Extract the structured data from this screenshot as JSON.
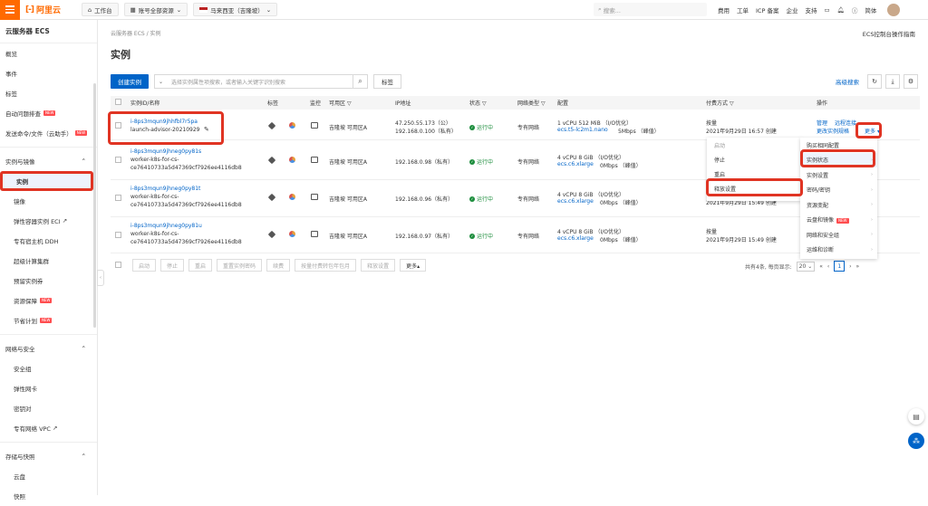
{
  "topbar": {
    "logo": "阿里云",
    "workbench": "工作台",
    "resources": "账号全部资源",
    "region": "马来西亚（吉隆坡）",
    "search_placeholder": "搜索...",
    "links": [
      "费用",
      "工单",
      "ICP 备案",
      "企业",
      "支持"
    ],
    "lang": "简体"
  },
  "sidebar": {
    "title": "云服务器 ECS",
    "items": [
      "概览",
      "事件",
      "标签",
      "自动问题排查",
      "发送命令/文件（云助手）"
    ],
    "group1": "实例与镜像",
    "group1_items": [
      "实例",
      "镜像",
      "弹性容器实例 ECI",
      "专有宿主机 DDH",
      "超级计算集群",
      "预留实例券",
      "资源保障",
      "节省计划"
    ],
    "group2": "网络与安全",
    "group2_items": [
      "安全组",
      "弹性网卡",
      "密钥对",
      "专有网络 VPC"
    ],
    "group3": "存储与快照",
    "group3_items": [
      "云盘",
      "快照"
    ],
    "new_badge": "NEW"
  },
  "main": {
    "breadcrumb": "云服务器 ECS / 实例",
    "guide": "ECS控制台操作指南",
    "title": "实例",
    "create_btn": "创建实例",
    "filter_placeholder": "选择实例属性项搜索，或者输入关键字识别搜索",
    "tag_btn": "标签",
    "advanced": "高级搜索",
    "headers": [
      "实例ID/名称",
      "标签",
      "监控",
      "可用区",
      "IP地址",
      "状态",
      "网络类型",
      "配置",
      "付费方式",
      "操作"
    ],
    "rows": [
      {
        "id": "i-8ps3mqun9jhhfbl7r5pa",
        "name": "launch-advisor-20210929",
        "name2": "",
        "zone": "吉隆坡 可用区A",
        "ip1": "47.250.55.173（公）",
        "ip2": "192.168.0.100（私有）",
        "status": "运行中",
        "net": "专有网络",
        "cfg": "1 vCPU 512 MiB （I/O优化）",
        "spec": "ecs.t5-lc2m1.nano",
        "bw": "5Mbps （峰值）",
        "pay": "按量",
        "date": "2021年9月29日 16:57 创建",
        "ops": [
          "管理",
          "远程连接",
          "更改实例规格",
          "更多"
        ]
      },
      {
        "id": "i-8ps3mqun9jhneg0py81s",
        "name": "worker-k8s-for-cs-",
        "name2": "ce76410733a5d47369cf7926ee4116db8",
        "zone": "吉隆坡 可用区A",
        "ip1": "192.168.0.98（私有）",
        "ip2": "",
        "status": "运行中",
        "net": "专有网络",
        "cfg": "4 vCPU 8 GiB （I/O优化）",
        "spec": "ecs.c6.xlarge",
        "bw": "0Mbps （峰值）",
        "pay": "",
        "date": "",
        "ops": []
      },
      {
        "id": "i-8ps3mqun9jhneg0py81t",
        "name": "worker-k8s-for-cs-",
        "name2": "ce76410733a5d47369cf7926ee4116db8",
        "zone": "吉隆坡 可用区A",
        "ip1": "192.168.0.96（私有）",
        "ip2": "",
        "status": "运行中",
        "net": "专有网络",
        "cfg": "4 vCPU 8 GiB （I/O优化）",
        "spec": "ecs.c6.xlarge",
        "bw": "0Mbps （峰值）",
        "pay": "",
        "date": "2021年9月29日 15:49 创建",
        "ops": []
      },
      {
        "id": "i-8ps3mqun9jhneg0py81u",
        "name": "worker-k8s-for-cs-",
        "name2": "ce76410733a5d47369cf7926ee4116db8",
        "zone": "吉隆坡 可用区A",
        "ip1": "192.168.0.97（私有）",
        "ip2": "",
        "status": "运行中",
        "net": "专有网络",
        "cfg": "4 vCPU 8 GiB （I/O优化）",
        "spec": "ecs.c6.xlarge",
        "bw": "0Mbps （峰值）",
        "pay": "按量",
        "date": "2021年9月29日 15:49 创建",
        "ops": []
      }
    ],
    "bulk": [
      "启动",
      "停止",
      "重启",
      "重置实例密码",
      "续费",
      "按量付费转包年包月",
      "释放设置",
      "更多▴"
    ],
    "pager": {
      "total": "共有4条, 每页显示:",
      "size": "20",
      "page": "1"
    }
  },
  "menu1": [
    "启动",
    "停止",
    "重启",
    "释放设置"
  ],
  "menu2": [
    "购买相同配置",
    "实例状态",
    "实例设置",
    "密码/密钥",
    "资源变配",
    "云盘和镜像",
    "网络和安全组",
    "运维和诊断"
  ],
  "colors": {
    "accent": "#0064c8",
    "brand": "#ff6a00",
    "highlight": "#e03423",
    "running": "#1e8e3e"
  }
}
